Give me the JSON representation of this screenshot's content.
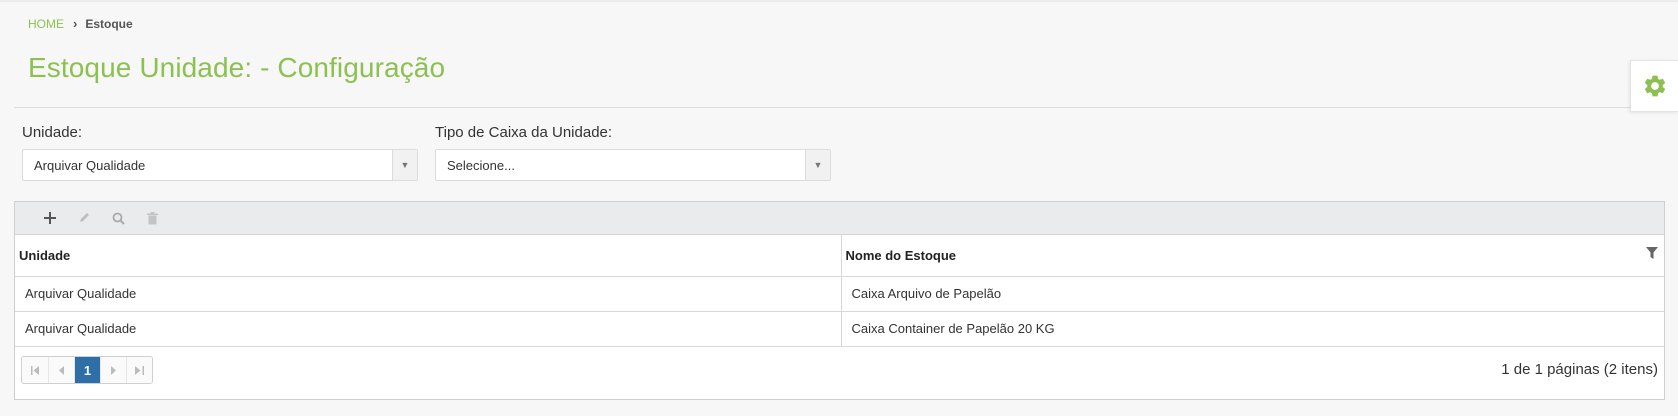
{
  "breadcrumb": {
    "home": "HOME",
    "current": "Estoque"
  },
  "page": {
    "title": "Estoque Unidade: - Configuração"
  },
  "filters": {
    "unidade": {
      "label": "Unidade:",
      "value": "Arquivar Qualidade"
    },
    "tipo_caixa": {
      "label": "Tipo de Caixa da Unidade:",
      "value": "Selecione..."
    }
  },
  "grid": {
    "toolbar": {
      "add_icon": "plus-icon",
      "edit_icon": "pencil-icon",
      "view_icon": "search-icon",
      "delete_icon": "trash-icon"
    },
    "columns": [
      "Unidade",
      "Nome do Estoque"
    ],
    "rows": [
      [
        "Arquivar Qualidade",
        "Caixa Arquivo de Papelão"
      ],
      [
        "Arquivar Qualidade",
        "Caixa Container de Papelão 20 KG"
      ]
    ],
    "pager": {
      "current_page": "1",
      "info": "1 de 1 páginas (2 itens)"
    }
  },
  "colors": {
    "accent": "#8cc152",
    "pager_active": "#2f6fa7"
  }
}
